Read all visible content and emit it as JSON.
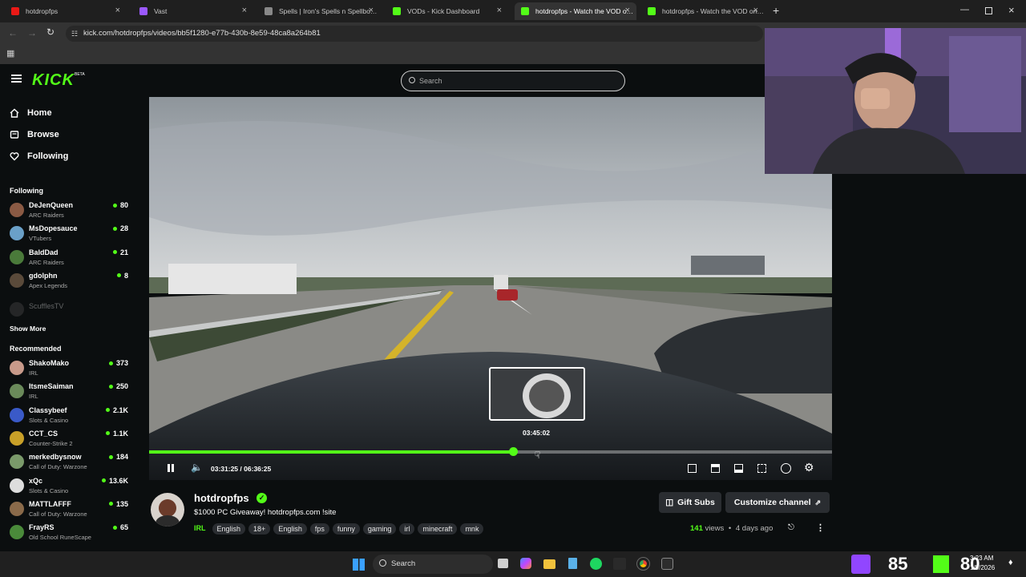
{
  "browser": {
    "tabs": [
      {
        "title": "hotdropfps",
        "favicon_color": "#e91916",
        "active": false
      },
      {
        "title": "Vast",
        "favicon_color": "#9b59ff",
        "active": false
      },
      {
        "title": "Spells | Iron's Spells n Spellbooks",
        "favicon_color": "#888888",
        "active": false
      },
      {
        "title": "VODs - Kick Dashboard",
        "favicon_color": "#53fc18",
        "active": false
      },
      {
        "title": "hotdropfps - Watch the VOD on Kick",
        "favicon_color": "#53fc18",
        "active": true
      },
      {
        "title": "hotdropfps - Watch the VOD on Kick",
        "favicon_color": "#53fc18",
        "active": false
      }
    ],
    "url": "kick.com/hotdropfps/videos/bb5f1280-e77b-430b-8e59-48ca8a264b81"
  },
  "site": {
    "logo": "KICK",
    "logo_badge": "BETA",
    "search_placeholder": "Search",
    "accent": "#53fc18"
  },
  "sidebar": {
    "nav": [
      {
        "label": "Home",
        "icon": "home-icon"
      },
      {
        "label": "Browse",
        "icon": "browse-icon"
      },
      {
        "label": "Following",
        "icon": "heart-icon"
      }
    ],
    "following_title": "Following",
    "following": [
      {
        "name": "DeJenQueen",
        "category": "ARC Raiders",
        "viewers": "80",
        "avatar_color": "#8a5a44"
      },
      {
        "name": "MsDopesauce",
        "category": "VTubers",
        "viewers": "28",
        "avatar_color": "#6aa0c8"
      },
      {
        "name": "BaldDad",
        "category": "ARC Raiders",
        "viewers": "21",
        "avatar_color": "#4a7a3a"
      },
      {
        "name": "gdolphn",
        "category": "Apex Legends",
        "viewers": "8",
        "avatar_color": "#5a4a3a"
      }
    ],
    "offline_channel": "ScufflesTV",
    "show_more": "Show More",
    "recommended_title": "Recommended",
    "recommended": [
      {
        "name": "ShakoMako",
        "category": "IRL",
        "viewers": "373",
        "avatar_color": "#c89a8a"
      },
      {
        "name": "ItsmeSaiman",
        "category": "IRL",
        "viewers": "250",
        "avatar_color": "#6a8a5a"
      },
      {
        "name": "Classybeef",
        "category": "Slots & Casino",
        "viewers": "2.1K",
        "avatar_color": "#3a5ac8"
      },
      {
        "name": "CCT_CS",
        "category": "Counter-Strike 2",
        "viewers": "1.1K",
        "avatar_color": "#c8a028"
      },
      {
        "name": "merkedbysnow",
        "category": "Call of Duty: Warzone",
        "viewers": "184",
        "avatar_color": "#7a9a6a"
      },
      {
        "name": "xQc",
        "category": "Slots & Casino",
        "viewers": "13.6K",
        "avatar_color": "#dddddd"
      },
      {
        "name": "MATTLAFFF",
        "category": "Call of Duty: Warzone",
        "viewers": "135",
        "avatar_color": "#8a6a4a"
      },
      {
        "name": "FrayRS",
        "category": "Old School RuneScape",
        "viewers": "65",
        "avatar_color": "#4a8a3a"
      }
    ]
  },
  "player": {
    "current_time": "03:31:25",
    "separator": "/",
    "duration": "06:36:25",
    "hover_time": "03:45:02",
    "progress": 0.533,
    "hover_position": 0.568
  },
  "channel": {
    "name": "hotdropfps",
    "title": "$1000 PC Giveaway! hotdropfps.com !site",
    "category": "IRL",
    "tags": [
      "English",
      "18+",
      "English",
      "fps",
      "funny",
      "gaming",
      "irl",
      "minecraft",
      "mnk"
    ],
    "gift_subs_label": "Gift Subs",
    "customize_label": "Customize channel",
    "views_count": "141",
    "views_label": "views",
    "dot": "•",
    "uploaded": "4 days ago"
  },
  "taskbar": {
    "search_label": "Search",
    "clock_time": "3:23 AM",
    "clock_date": "1/9/2026"
  },
  "overlay": {
    "twitch_count": "85",
    "kick_count": "80"
  }
}
